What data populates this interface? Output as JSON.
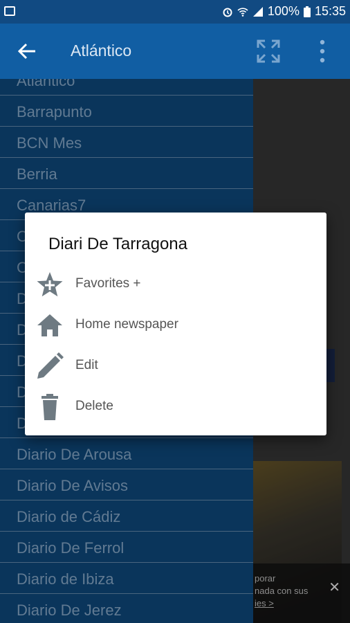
{
  "status_bar": {
    "battery": "100%",
    "time": "15:35"
  },
  "app_bar": {
    "title": "Atlántico"
  },
  "drawer": {
    "items": [
      "Atlántico",
      "Barrapunto",
      "BCN Mes",
      "Berria",
      "Canarias7",
      "C",
      "C",
      "D",
      "D",
      "D",
      "D",
      "D",
      "Diario De Arousa",
      "Diario De Avisos",
      "Diario de Cádiz",
      "Diario De Ferrol",
      "Diario de Ibiza",
      "Diario De Jerez"
    ]
  },
  "dialog": {
    "title": "Diari De Tarragona",
    "options": [
      {
        "label": "Favorites +",
        "icon": "star-plus-icon"
      },
      {
        "label": "Home newspaper",
        "icon": "home-icon"
      },
      {
        "label": "Edit",
        "icon": "pencil-icon"
      },
      {
        "label": "Delete",
        "icon": "trash-icon"
      }
    ]
  },
  "background_ad": {
    "line1": "porar",
    "line2": "nada con sus",
    "line3": "ies >",
    "close": "✕"
  },
  "colors": {
    "status_bar": "#114a82",
    "app_bar": "#115ea3",
    "drawer": "#0f4f86",
    "drawer_text": "#8fb4d8",
    "icon_gray": "#6e7a82"
  }
}
